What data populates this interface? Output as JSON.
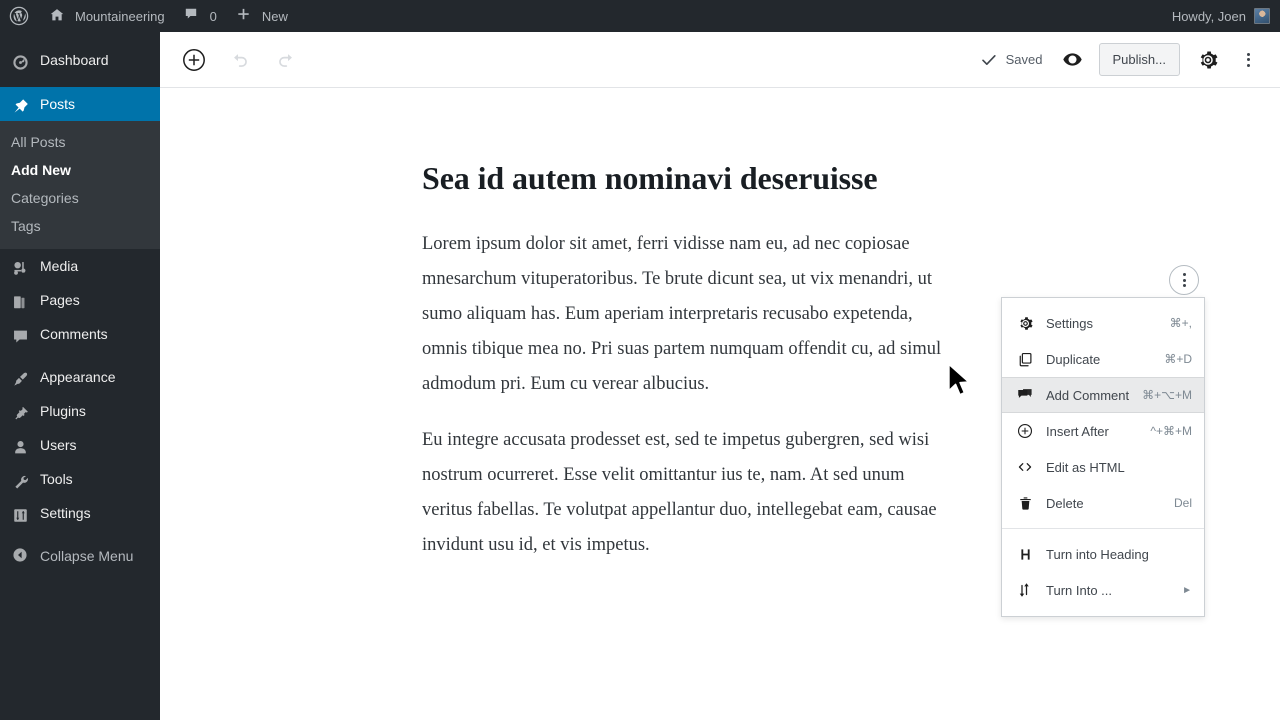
{
  "adminbar": {
    "logo_icon": "wordpress-logo-icon",
    "site": {
      "icon": "home-icon",
      "label": "Mountaineering"
    },
    "comments": {
      "icon": "comment-bubble-icon",
      "count": "0"
    },
    "new": {
      "icon": "plus-icon",
      "label": "New"
    },
    "account": {
      "greeting": "Howdy, Joen",
      "avatar_icon": "user-avatar"
    }
  },
  "sidebar": {
    "items": [
      {
        "label": "Dashboard",
        "icon": "dashboard-gauge-icon",
        "current": false
      },
      {
        "label": "Posts",
        "icon": "pin-icon",
        "current": true
      },
      {
        "label": "Media",
        "icon": "media-icon",
        "current": false
      },
      {
        "label": "Pages",
        "icon": "pages-icon",
        "current": false
      },
      {
        "label": "Comments",
        "icon": "comment-bubble-icon",
        "current": false
      },
      {
        "label": "Appearance",
        "icon": "paintbrush-icon",
        "current": false
      },
      {
        "label": "Plugins",
        "icon": "plug-icon",
        "current": false
      },
      {
        "label": "Users",
        "icon": "user-icon",
        "current": false
      },
      {
        "label": "Tools",
        "icon": "wrench-icon",
        "current": false
      },
      {
        "label": "Settings",
        "icon": "sliders-icon",
        "current": false
      }
    ],
    "posts_submenu": [
      {
        "label": "All Posts",
        "active": false
      },
      {
        "label": "Add New",
        "active": true
      },
      {
        "label": "Categories",
        "active": false
      },
      {
        "label": "Tags",
        "active": false
      }
    ],
    "collapse": {
      "label": "Collapse Menu",
      "icon": "collapse-arrow-icon"
    },
    "active_color": "#0073aa",
    "background_color": "#23282d"
  },
  "editor_toolbar": {
    "add_block": {
      "icon": "circle-plus-icon",
      "label": "Add block"
    },
    "undo": {
      "icon": "undo-arrow-icon",
      "label": "Undo",
      "disabled": true
    },
    "redo": {
      "icon": "redo-arrow-icon",
      "label": "Redo",
      "disabled": true
    },
    "save_status": {
      "icon": "checkmark-icon",
      "label": "Saved"
    },
    "preview": {
      "icon": "eye-icon",
      "label": "Preview"
    },
    "publish": {
      "label": "Publish..."
    },
    "settings": {
      "icon": "gear-icon",
      "label": "Settings"
    },
    "more": {
      "icon": "ellipsis-vertical-icon",
      "label": "Options"
    }
  },
  "post": {
    "title": "Sea id autem nominavi deseruisse",
    "paragraphs": [
      "Lorem ipsum dolor sit amet, ferri vidisse nam eu, ad nec copiosae mnesarchum vituperatoribus. Te brute dicunt sea, ut vix menandri, ut sumo aliquam has. Eum aperiam interpretaris recusabo expetenda, omnis tibique mea no. Pri suas partem numquam offendit cu, ad simul admodum pri. Eum cu verear albucius.",
      "Eu integre accusata prodesset est, sed te impetus gubergren, sed wisi nostrum ocurreret. Esse velit omittantur ius te, nam. At sed unum veritus fabellas. Te volutpat appellantur duo, intellegebat eam, causae invidunt usu id, et vis impetus."
    ]
  },
  "block_toolbar": {
    "more_options": {
      "icon": "ellipsis-vertical-icon",
      "label": "More options"
    }
  },
  "block_menu": {
    "groups": [
      [
        {
          "label": "Settings",
          "shortcut": "⌘+,",
          "icon": "gear-icon",
          "highlighted": false
        },
        {
          "label": "Duplicate",
          "shortcut": "⌘+D",
          "icon": "copy-icon",
          "highlighted": false
        },
        {
          "label": "Add Comment",
          "shortcut": "⌘+⌥+M",
          "icon": "comment-icon",
          "highlighted": true
        },
        {
          "label": "Insert After",
          "shortcut": "^+⌘+M",
          "icon": "circle-plus-icon",
          "highlighted": false
        },
        {
          "label": "Edit as HTML",
          "shortcut": "",
          "icon": "code-brackets-icon",
          "highlighted": false
        },
        {
          "label": "Delete",
          "shortcut": "Del",
          "icon": "trash-icon",
          "highlighted": false
        }
      ],
      [
        {
          "label": "Turn into Heading",
          "shortcut": "",
          "icon": "heading-h-icon",
          "highlighted": false
        },
        {
          "label": "Turn Into ...",
          "shortcut": "",
          "icon": "transform-icon",
          "submenu": true,
          "highlighted": false
        }
      ]
    ],
    "highlight_color": "#e9eaeb"
  },
  "cursor": {
    "icon": "mouse-pointer-icon"
  }
}
